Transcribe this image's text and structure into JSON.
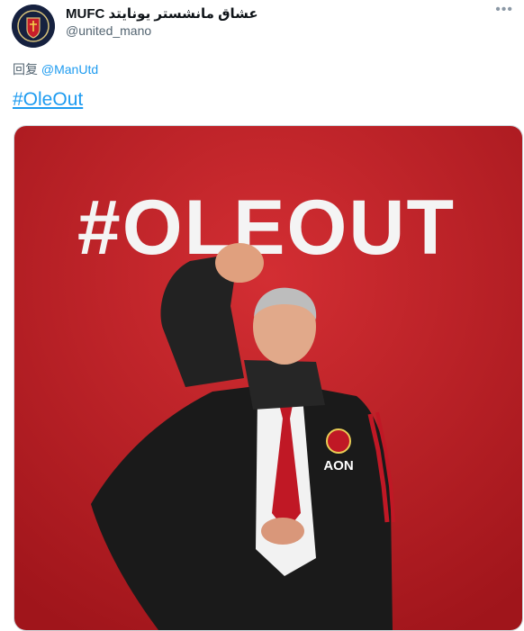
{
  "user": {
    "display_name": "MUFC عشاق مانشستر يونايتد",
    "handle": "@united_mano",
    "avatar_icon": "mufc-crest-icon"
  },
  "menu_icon": "more-options-icon",
  "reply": {
    "prefix": "回复",
    "mention": "@ManUtd"
  },
  "tweet": {
    "hashtag": "#OleOut"
  },
  "media": {
    "headline": "#OLEOUT",
    "shirt_sponsor": "AON",
    "background_color": "#c4232b"
  },
  "colors": {
    "link": "#1d9bf0",
    "secondary_text": "#536471"
  }
}
